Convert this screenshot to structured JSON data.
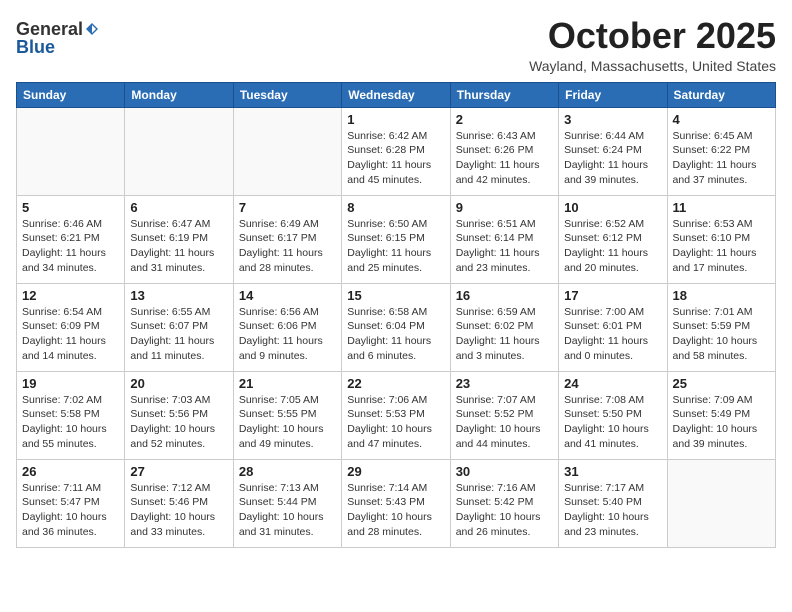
{
  "header": {
    "logo_general": "General",
    "logo_blue": "Blue",
    "month": "October 2025",
    "location": "Wayland, Massachusetts, United States"
  },
  "days_of_week": [
    "Sunday",
    "Monday",
    "Tuesday",
    "Wednesday",
    "Thursday",
    "Friday",
    "Saturday"
  ],
  "weeks": [
    [
      {
        "day": "",
        "info": ""
      },
      {
        "day": "",
        "info": ""
      },
      {
        "day": "",
        "info": ""
      },
      {
        "day": "1",
        "info": "Sunrise: 6:42 AM\nSunset: 6:28 PM\nDaylight: 11 hours\nand 45 minutes."
      },
      {
        "day": "2",
        "info": "Sunrise: 6:43 AM\nSunset: 6:26 PM\nDaylight: 11 hours\nand 42 minutes."
      },
      {
        "day": "3",
        "info": "Sunrise: 6:44 AM\nSunset: 6:24 PM\nDaylight: 11 hours\nand 39 minutes."
      },
      {
        "day": "4",
        "info": "Sunrise: 6:45 AM\nSunset: 6:22 PM\nDaylight: 11 hours\nand 37 minutes."
      }
    ],
    [
      {
        "day": "5",
        "info": "Sunrise: 6:46 AM\nSunset: 6:21 PM\nDaylight: 11 hours\nand 34 minutes."
      },
      {
        "day": "6",
        "info": "Sunrise: 6:47 AM\nSunset: 6:19 PM\nDaylight: 11 hours\nand 31 minutes."
      },
      {
        "day": "7",
        "info": "Sunrise: 6:49 AM\nSunset: 6:17 PM\nDaylight: 11 hours\nand 28 minutes."
      },
      {
        "day": "8",
        "info": "Sunrise: 6:50 AM\nSunset: 6:15 PM\nDaylight: 11 hours\nand 25 minutes."
      },
      {
        "day": "9",
        "info": "Sunrise: 6:51 AM\nSunset: 6:14 PM\nDaylight: 11 hours\nand 23 minutes."
      },
      {
        "day": "10",
        "info": "Sunrise: 6:52 AM\nSunset: 6:12 PM\nDaylight: 11 hours\nand 20 minutes."
      },
      {
        "day": "11",
        "info": "Sunrise: 6:53 AM\nSunset: 6:10 PM\nDaylight: 11 hours\nand 17 minutes."
      }
    ],
    [
      {
        "day": "12",
        "info": "Sunrise: 6:54 AM\nSunset: 6:09 PM\nDaylight: 11 hours\nand 14 minutes."
      },
      {
        "day": "13",
        "info": "Sunrise: 6:55 AM\nSunset: 6:07 PM\nDaylight: 11 hours\nand 11 minutes."
      },
      {
        "day": "14",
        "info": "Sunrise: 6:56 AM\nSunset: 6:06 PM\nDaylight: 11 hours\nand 9 minutes."
      },
      {
        "day": "15",
        "info": "Sunrise: 6:58 AM\nSunset: 6:04 PM\nDaylight: 11 hours\nand 6 minutes."
      },
      {
        "day": "16",
        "info": "Sunrise: 6:59 AM\nSunset: 6:02 PM\nDaylight: 11 hours\nand 3 minutes."
      },
      {
        "day": "17",
        "info": "Sunrise: 7:00 AM\nSunset: 6:01 PM\nDaylight: 11 hours\nand 0 minutes."
      },
      {
        "day": "18",
        "info": "Sunrise: 7:01 AM\nSunset: 5:59 PM\nDaylight: 10 hours\nand 58 minutes."
      }
    ],
    [
      {
        "day": "19",
        "info": "Sunrise: 7:02 AM\nSunset: 5:58 PM\nDaylight: 10 hours\nand 55 minutes."
      },
      {
        "day": "20",
        "info": "Sunrise: 7:03 AM\nSunset: 5:56 PM\nDaylight: 10 hours\nand 52 minutes."
      },
      {
        "day": "21",
        "info": "Sunrise: 7:05 AM\nSunset: 5:55 PM\nDaylight: 10 hours\nand 49 minutes."
      },
      {
        "day": "22",
        "info": "Sunrise: 7:06 AM\nSunset: 5:53 PM\nDaylight: 10 hours\nand 47 minutes."
      },
      {
        "day": "23",
        "info": "Sunrise: 7:07 AM\nSunset: 5:52 PM\nDaylight: 10 hours\nand 44 minutes."
      },
      {
        "day": "24",
        "info": "Sunrise: 7:08 AM\nSunset: 5:50 PM\nDaylight: 10 hours\nand 41 minutes."
      },
      {
        "day": "25",
        "info": "Sunrise: 7:09 AM\nSunset: 5:49 PM\nDaylight: 10 hours\nand 39 minutes."
      }
    ],
    [
      {
        "day": "26",
        "info": "Sunrise: 7:11 AM\nSunset: 5:47 PM\nDaylight: 10 hours\nand 36 minutes."
      },
      {
        "day": "27",
        "info": "Sunrise: 7:12 AM\nSunset: 5:46 PM\nDaylight: 10 hours\nand 33 minutes."
      },
      {
        "day": "28",
        "info": "Sunrise: 7:13 AM\nSunset: 5:44 PM\nDaylight: 10 hours\nand 31 minutes."
      },
      {
        "day": "29",
        "info": "Sunrise: 7:14 AM\nSunset: 5:43 PM\nDaylight: 10 hours\nand 28 minutes."
      },
      {
        "day": "30",
        "info": "Sunrise: 7:16 AM\nSunset: 5:42 PM\nDaylight: 10 hours\nand 26 minutes."
      },
      {
        "day": "31",
        "info": "Sunrise: 7:17 AM\nSunset: 5:40 PM\nDaylight: 10 hours\nand 23 minutes."
      },
      {
        "day": "",
        "info": ""
      }
    ]
  ]
}
